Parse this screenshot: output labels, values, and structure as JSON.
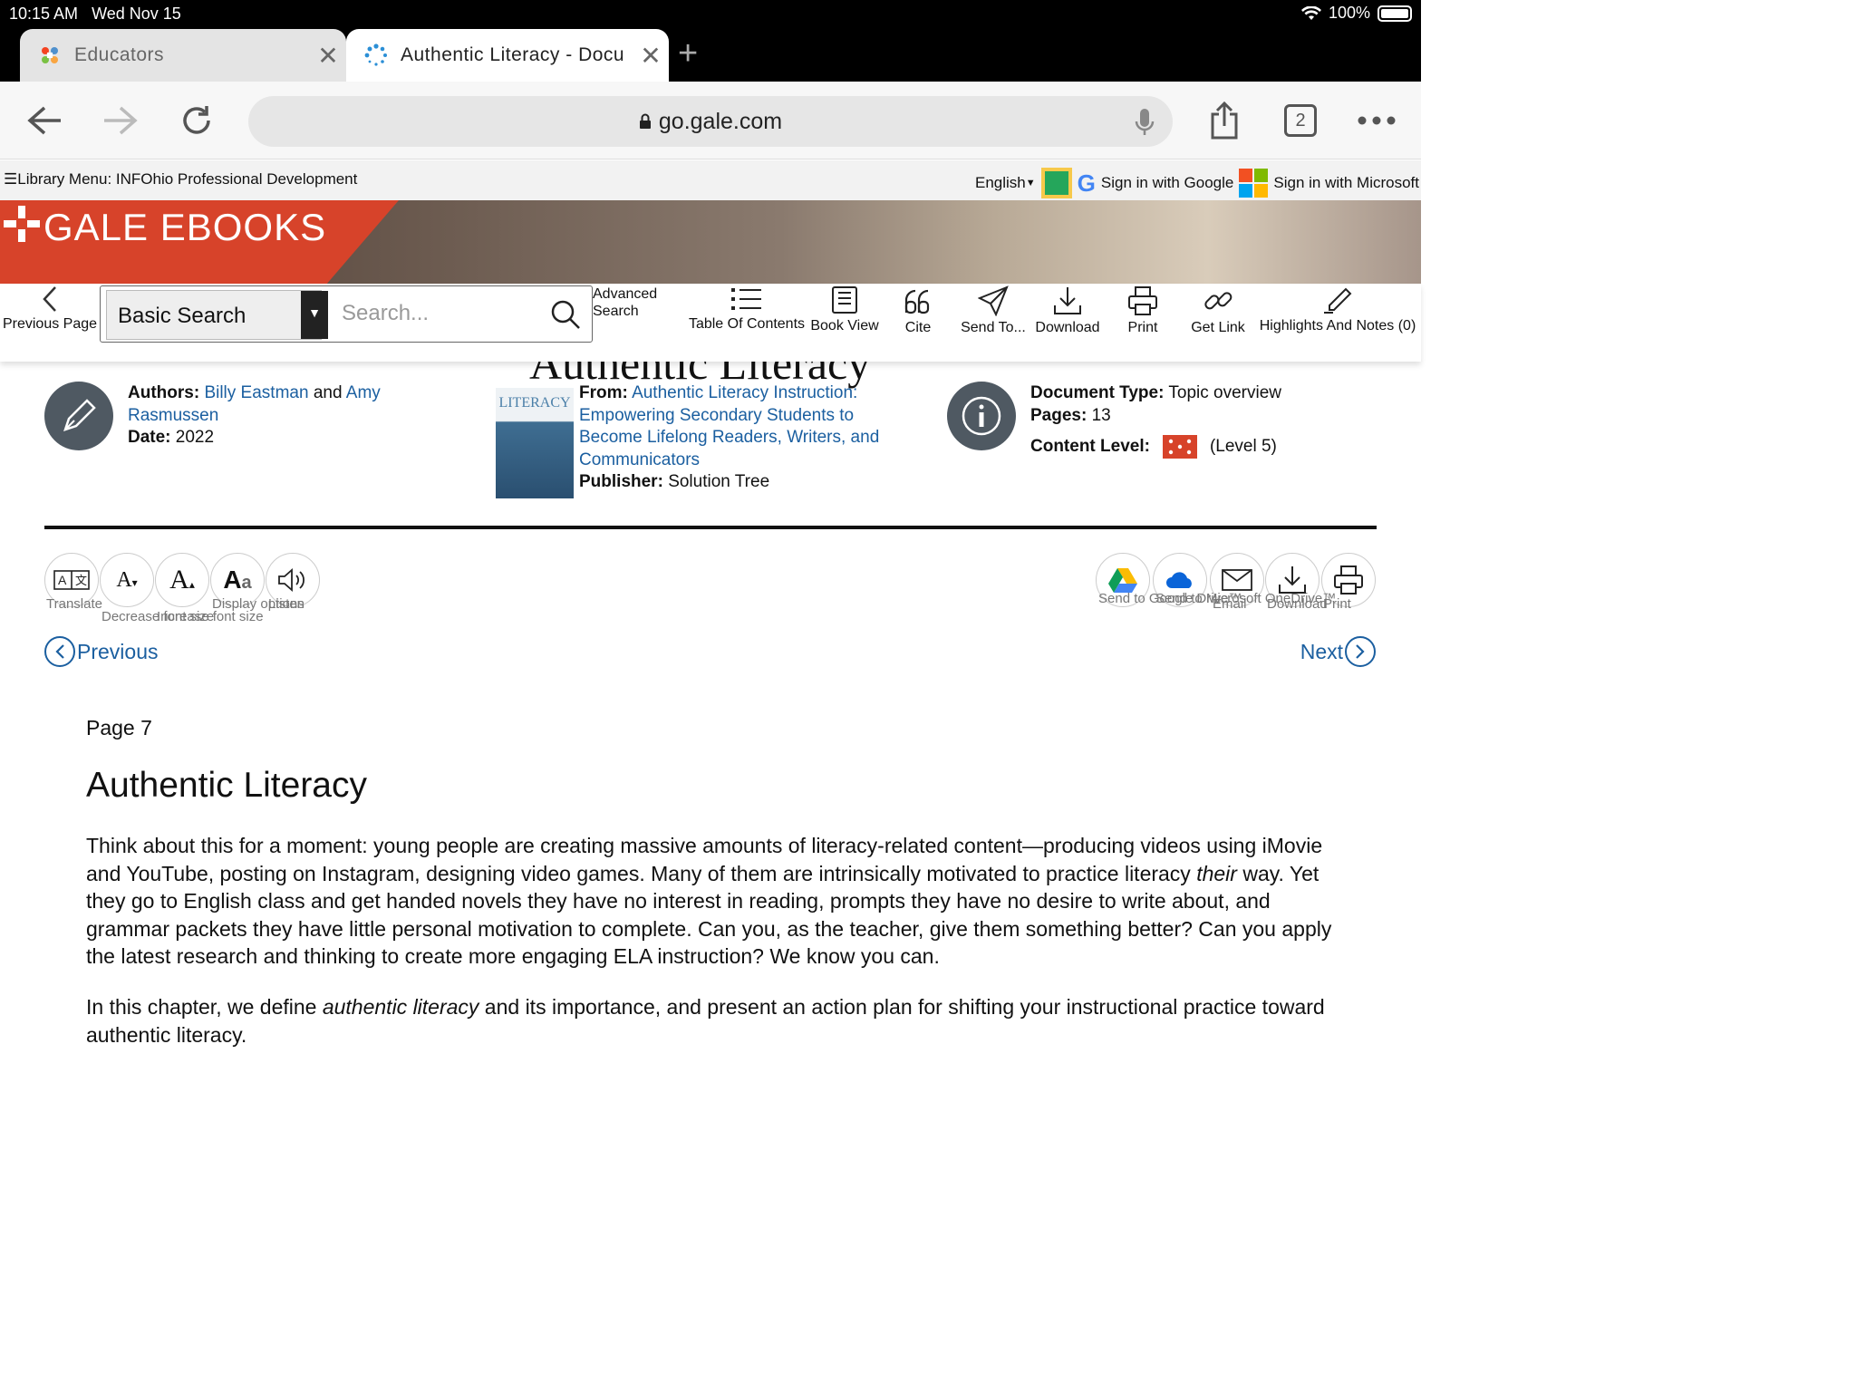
{
  "status": {
    "time": "10:15 AM",
    "date": "Wed Nov 15",
    "battery": "100%"
  },
  "tabs": [
    {
      "title": "Educators",
      "active": false
    },
    {
      "title": "Authentic Literacy - Docu",
      "active": true
    }
  ],
  "toolbar": {
    "url": "go.gale.com",
    "tab_count": "2"
  },
  "libbar": {
    "menu": "Library Menu: INFOhio Professional Development",
    "language": "English",
    "google": "Sign in with Google",
    "microsoft": "Sign in with Microsoft"
  },
  "banner": {
    "logo": "GALE EBOOKS"
  },
  "actions": {
    "previous_page": "Previous Page",
    "search_type": "Basic Search",
    "search_placeholder": "Search...",
    "advanced_1": "Advanced",
    "advanced_2": "Search",
    "toc": "Table Of Contents",
    "book_view": "Book View",
    "cite": "Cite",
    "send_to": "Send To...",
    "download": "Download",
    "print": "Print",
    "get_link": "Get Link",
    "highlights": "Highlights And Notes (0)"
  },
  "heading_cut": "Authentic Literacy",
  "meta": {
    "authors_label": "Authors:",
    "author1": "Billy Eastman",
    "and": "and",
    "author2a": "Amy",
    "author2b": "Rasmussen",
    "date_label": "Date:",
    "date": "2022",
    "from_label": "From:",
    "from_1": "Authentic Literacy Instruction:",
    "from_2": "Empowering Secondary Students to",
    "from_3": "Become Lifelong Readers, Writers, and",
    "from_4": "Communicators",
    "publisher_label": "Publisher:",
    "publisher": "Solution Tree",
    "doctype_label": "Document Type:",
    "doctype": "Topic overview",
    "pages_label": "Pages:",
    "pages": "13",
    "level_label": "Content Level:",
    "level": "(Level 5)",
    "level_value": 5
  },
  "tools": {
    "translate": "Translate",
    "decrease": "Decrease font size",
    "increase": "Increase font size",
    "display": "Display options",
    "listen": "Listen",
    "gdrive": "Send to Google Drive™",
    "onedrive": "Send to Microsoft OneDrive™",
    "email": "Email",
    "download": "Download",
    "print": "Print"
  },
  "nav": {
    "previous": "Previous",
    "next": "Next"
  },
  "content": {
    "page_label": "Page 7",
    "title": "Authentic Literacy",
    "p1_a": "Think about this for a moment: young people are creating massive amounts of literacy-related content—producing videos using iMovie and YouTube, posting on Instagram, designing video games. Many of them are intrinsically motivated to practice literacy ",
    "p1_em": "their",
    "p1_b": " way. Yet they go to English class and get handed novels they have no interest in reading, prompts they have no desire to write about, and grammar packets they have little personal motivation to complete. Can you, as the teacher, give them something better? Can you apply the latest research and thinking to create more engaging ELA instruction? We know you can.",
    "p2_a": "In this chapter, we define ",
    "p2_em": "authentic literacy",
    "p2_b": " and its importance, and present an action plan for shifting your instructional practice toward authentic literacy."
  }
}
